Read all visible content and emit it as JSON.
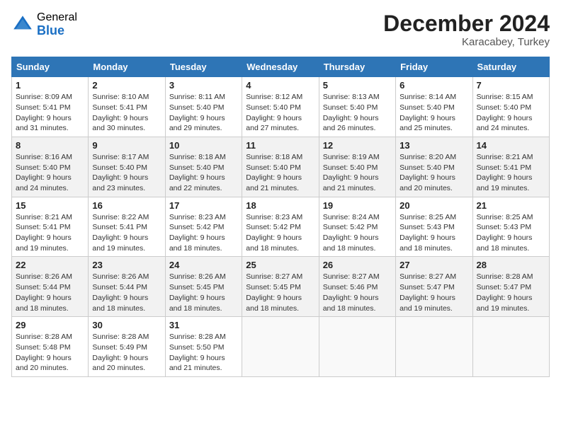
{
  "header": {
    "logo_general": "General",
    "logo_blue": "Blue",
    "month_title": "December 2024",
    "subtitle": "Karacabey, Turkey"
  },
  "calendar": {
    "days_of_week": [
      "Sunday",
      "Monday",
      "Tuesday",
      "Wednesday",
      "Thursday",
      "Friday",
      "Saturday"
    ],
    "weeks": [
      [
        {
          "day": "1",
          "sunrise": "Sunrise: 8:09 AM",
          "sunset": "Sunset: 5:41 PM",
          "daylight": "Daylight: 9 hours and 31 minutes."
        },
        {
          "day": "2",
          "sunrise": "Sunrise: 8:10 AM",
          "sunset": "Sunset: 5:41 PM",
          "daylight": "Daylight: 9 hours and 30 minutes."
        },
        {
          "day": "3",
          "sunrise": "Sunrise: 8:11 AM",
          "sunset": "Sunset: 5:40 PM",
          "daylight": "Daylight: 9 hours and 29 minutes."
        },
        {
          "day": "4",
          "sunrise": "Sunrise: 8:12 AM",
          "sunset": "Sunset: 5:40 PM",
          "daylight": "Daylight: 9 hours and 27 minutes."
        },
        {
          "day": "5",
          "sunrise": "Sunrise: 8:13 AM",
          "sunset": "Sunset: 5:40 PM",
          "daylight": "Daylight: 9 hours and 26 minutes."
        },
        {
          "day": "6",
          "sunrise": "Sunrise: 8:14 AM",
          "sunset": "Sunset: 5:40 PM",
          "daylight": "Daylight: 9 hours and 25 minutes."
        },
        {
          "day": "7",
          "sunrise": "Sunrise: 8:15 AM",
          "sunset": "Sunset: 5:40 PM",
          "daylight": "Daylight: 9 hours and 24 minutes."
        }
      ],
      [
        {
          "day": "8",
          "sunrise": "Sunrise: 8:16 AM",
          "sunset": "Sunset: 5:40 PM",
          "daylight": "Daylight: 9 hours and 24 minutes."
        },
        {
          "day": "9",
          "sunrise": "Sunrise: 8:17 AM",
          "sunset": "Sunset: 5:40 PM",
          "daylight": "Daylight: 9 hours and 23 minutes."
        },
        {
          "day": "10",
          "sunrise": "Sunrise: 8:18 AM",
          "sunset": "Sunset: 5:40 PM",
          "daylight": "Daylight: 9 hours and 22 minutes."
        },
        {
          "day": "11",
          "sunrise": "Sunrise: 8:18 AM",
          "sunset": "Sunset: 5:40 PM",
          "daylight": "Daylight: 9 hours and 21 minutes."
        },
        {
          "day": "12",
          "sunrise": "Sunrise: 8:19 AM",
          "sunset": "Sunset: 5:40 PM",
          "daylight": "Daylight: 9 hours and 21 minutes."
        },
        {
          "day": "13",
          "sunrise": "Sunrise: 8:20 AM",
          "sunset": "Sunset: 5:40 PM",
          "daylight": "Daylight: 9 hours and 20 minutes."
        },
        {
          "day": "14",
          "sunrise": "Sunrise: 8:21 AM",
          "sunset": "Sunset: 5:41 PM",
          "daylight": "Daylight: 9 hours and 19 minutes."
        }
      ],
      [
        {
          "day": "15",
          "sunrise": "Sunrise: 8:21 AM",
          "sunset": "Sunset: 5:41 PM",
          "daylight": "Daylight: 9 hours and 19 minutes."
        },
        {
          "day": "16",
          "sunrise": "Sunrise: 8:22 AM",
          "sunset": "Sunset: 5:41 PM",
          "daylight": "Daylight: 9 hours and 19 minutes."
        },
        {
          "day": "17",
          "sunrise": "Sunrise: 8:23 AM",
          "sunset": "Sunset: 5:42 PM",
          "daylight": "Daylight: 9 hours and 18 minutes."
        },
        {
          "day": "18",
          "sunrise": "Sunrise: 8:23 AM",
          "sunset": "Sunset: 5:42 PM",
          "daylight": "Daylight: 9 hours and 18 minutes."
        },
        {
          "day": "19",
          "sunrise": "Sunrise: 8:24 AM",
          "sunset": "Sunset: 5:42 PM",
          "daylight": "Daylight: 9 hours and 18 minutes."
        },
        {
          "day": "20",
          "sunrise": "Sunrise: 8:25 AM",
          "sunset": "Sunset: 5:43 PM",
          "daylight": "Daylight: 9 hours and 18 minutes."
        },
        {
          "day": "21",
          "sunrise": "Sunrise: 8:25 AM",
          "sunset": "Sunset: 5:43 PM",
          "daylight": "Daylight: 9 hours and 18 minutes."
        }
      ],
      [
        {
          "day": "22",
          "sunrise": "Sunrise: 8:26 AM",
          "sunset": "Sunset: 5:44 PM",
          "daylight": "Daylight: 9 hours and 18 minutes."
        },
        {
          "day": "23",
          "sunrise": "Sunrise: 8:26 AM",
          "sunset": "Sunset: 5:44 PM",
          "daylight": "Daylight: 9 hours and 18 minutes."
        },
        {
          "day": "24",
          "sunrise": "Sunrise: 8:26 AM",
          "sunset": "Sunset: 5:45 PM",
          "daylight": "Daylight: 9 hours and 18 minutes."
        },
        {
          "day": "25",
          "sunrise": "Sunrise: 8:27 AM",
          "sunset": "Sunset: 5:45 PM",
          "daylight": "Daylight: 9 hours and 18 minutes."
        },
        {
          "day": "26",
          "sunrise": "Sunrise: 8:27 AM",
          "sunset": "Sunset: 5:46 PM",
          "daylight": "Daylight: 9 hours and 18 minutes."
        },
        {
          "day": "27",
          "sunrise": "Sunrise: 8:27 AM",
          "sunset": "Sunset: 5:47 PM",
          "daylight": "Daylight: 9 hours and 19 minutes."
        },
        {
          "day": "28",
          "sunrise": "Sunrise: 8:28 AM",
          "sunset": "Sunset: 5:47 PM",
          "daylight": "Daylight: 9 hours and 19 minutes."
        }
      ],
      [
        {
          "day": "29",
          "sunrise": "Sunrise: 8:28 AM",
          "sunset": "Sunset: 5:48 PM",
          "daylight": "Daylight: 9 hours and 20 minutes."
        },
        {
          "day": "30",
          "sunrise": "Sunrise: 8:28 AM",
          "sunset": "Sunset: 5:49 PM",
          "daylight": "Daylight: 9 hours and 20 minutes."
        },
        {
          "day": "31",
          "sunrise": "Sunrise: 8:28 AM",
          "sunset": "Sunset: 5:50 PM",
          "daylight": "Daylight: 9 hours and 21 minutes."
        },
        null,
        null,
        null,
        null
      ]
    ]
  }
}
